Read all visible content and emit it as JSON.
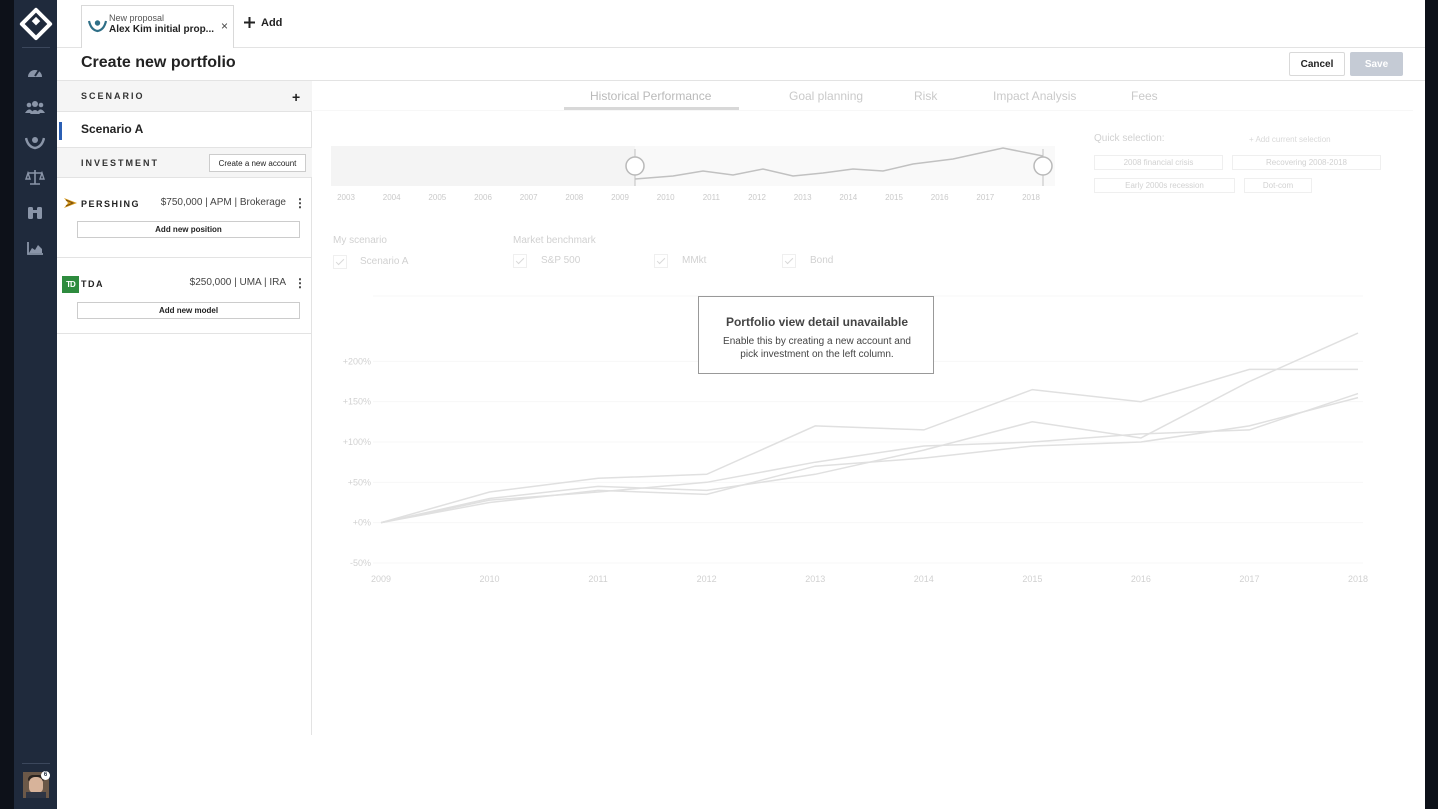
{
  "header": {
    "tab_small": "New proposal",
    "tab_title": "Alex Kim initial prop...",
    "tab_close": "×",
    "add_label": "Add"
  },
  "page": {
    "title": "Create new portfolio",
    "cancel": "Cancel",
    "save": "Save"
  },
  "sidebar_icons": [
    "dashboard-icon",
    "clients-icon",
    "proposals-icon",
    "balance-icon",
    "binoculars-icon",
    "analytics-icon"
  ],
  "left": {
    "scenario_header": "SCENARIO",
    "scenario_name": "Scenario A",
    "investment_header": "INVESTMENT",
    "create_account": "Create a new account",
    "accounts": [
      {
        "name": "PERSHING",
        "detail": "$750,000 | APM | Brokerage",
        "button": "Add new position"
      },
      {
        "name": "TDA",
        "logo": "TD",
        "detail": "$250,000 | UMA | IRA",
        "button": "Add new model"
      }
    ]
  },
  "tabs": [
    "Historical Performance",
    "Goal planning",
    "Risk",
    "Impact Analysis",
    "Fees"
  ],
  "timeline": {
    "years": [
      "2003",
      "2004",
      "2005",
      "2006",
      "2007",
      "2008",
      "2009",
      "2010",
      "2011",
      "2012",
      "2013",
      "2014",
      "2015",
      "2016",
      "2017",
      "2018"
    ]
  },
  "quick": {
    "title": "Quick selection:",
    "add": "+ Add current selection",
    "chips": [
      "2008 financial crisis",
      "Recovering 2008-2018",
      "Early 2000s recession",
      "Dot-com"
    ]
  },
  "legend": {
    "my_scenario": "My scenario",
    "scenario_item": "Scenario A",
    "market_benchmark": "Market benchmark",
    "benchmarks": [
      "S&P 500",
      "MMkt",
      "Bond"
    ]
  },
  "overlay": {
    "title": "Portfolio view detail unavailable",
    "body": "Enable this by creating a new account and pick investment on the left column."
  },
  "chart_data": {
    "type": "line",
    "title": "",
    "xlabel": "",
    "ylabel": "",
    "x": [
      "2009",
      "2010",
      "2011",
      "2012",
      "2013",
      "2014",
      "2015",
      "2016",
      "2017",
      "2018"
    ],
    "yticks": [
      "+200%",
      "+150%",
      "+100%",
      "+50%",
      "+0%",
      "-50%"
    ],
    "ylim": [
      -50,
      250
    ],
    "series": [
      {
        "values": [
          0,
          30,
          45,
          40,
          60,
          90,
          125,
          105,
          175,
          235
        ]
      },
      {
        "values": [
          0,
          38,
          55,
          60,
          120,
          115,
          165,
          150,
          190,
          190
        ]
      },
      {
        "values": [
          0,
          25,
          40,
          35,
          70,
          80,
          95,
          100,
          120,
          155
        ]
      },
      {
        "values": [
          0,
          28,
          38,
          50,
          75,
          95,
          100,
          110,
          115,
          160
        ]
      }
    ],
    "colors": [
      "#bbbbbb"
    ],
    "grid": true
  }
}
